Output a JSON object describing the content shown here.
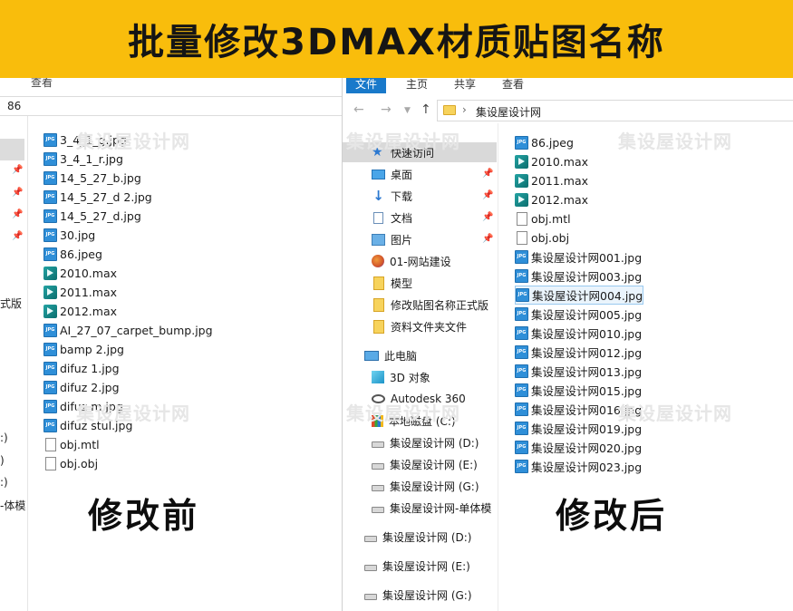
{
  "banner": {
    "title": "批量修改3DMAX材质贴图名称"
  },
  "left_window": {
    "ribbon_tab_visible": "查看",
    "address_text": "86",
    "nav_partial_labels": [
      "式版",
      ":)",
      ")",
      ":)",
      "-体模"
    ],
    "files": [
      {
        "name": "3_4_1_g.jpg",
        "type": "jpg"
      },
      {
        "name": "3_4_1_r.jpg",
        "type": "jpg"
      },
      {
        "name": "14_5_27_b.jpg",
        "type": "jpg"
      },
      {
        "name": "14_5_27_d 2.jpg",
        "type": "jpg"
      },
      {
        "name": "14_5_27_d.jpg",
        "type": "jpg"
      },
      {
        "name": "30.jpg",
        "type": "jpg"
      },
      {
        "name": "86.jpeg",
        "type": "jpg"
      },
      {
        "name": "2010.max",
        "type": "max"
      },
      {
        "name": "2011.max",
        "type": "max"
      },
      {
        "name": "2012.max",
        "type": "max"
      },
      {
        "name": "AI_27_07_carpet_bump.jpg",
        "type": "jpg"
      },
      {
        "name": "bamp 2.jpg",
        "type": "jpg"
      },
      {
        "name": "difuz 1.jpg",
        "type": "jpg"
      },
      {
        "name": "difuz 2.jpg",
        "type": "jpg"
      },
      {
        "name": "difuz m.jpg",
        "type": "jpg"
      },
      {
        "name": "difuz stul.jpg",
        "type": "jpg"
      },
      {
        "name": "obj.mtl",
        "type": "doc"
      },
      {
        "name": "obj.obj",
        "type": "doc"
      }
    ],
    "caption": "修改前"
  },
  "right_window": {
    "ribbon_tabs": [
      "文件",
      "主页",
      "共享",
      "查看"
    ],
    "active_tab": "文件",
    "address_text": "集设屋设计网",
    "nav_items": [
      {
        "label": "快速访问",
        "icon": "star-icon",
        "selected": true,
        "pinned": false
      },
      {
        "label": "桌面",
        "icon": "desktop-icon",
        "pinned": true
      },
      {
        "label": "下载",
        "icon": "download-icon",
        "pinned": true
      },
      {
        "label": "文档",
        "icon": "documents-icon",
        "pinned": true
      },
      {
        "label": "图片",
        "icon": "pictures-icon",
        "pinned": true
      },
      {
        "label": "01-网站建设",
        "icon": "web-icon",
        "pinned": false
      },
      {
        "label": "模型",
        "icon": "folder-icon",
        "pinned": false
      },
      {
        "label": "修改贴图名称正式版",
        "icon": "folder-icon",
        "pinned": false
      },
      {
        "label": "资料文件夹文件",
        "icon": "folder-icon",
        "pinned": false
      },
      {
        "label": "此电脑",
        "icon": "this-pc-icon",
        "pinned": false
      },
      {
        "label": "3D 对象",
        "icon": "3d-objects-icon",
        "pinned": false
      },
      {
        "label": "Autodesk 360",
        "icon": "autodesk-360-icon",
        "pinned": false
      },
      {
        "label": "本地磁盘 (C:)",
        "icon": "local-disk-icon",
        "pinned": false
      },
      {
        "label": "集设屋设计网 (D:)",
        "icon": "drive-icon",
        "pinned": false
      },
      {
        "label": "集设屋设计网 (E:)",
        "icon": "drive-icon",
        "pinned": false
      },
      {
        "label": "集设屋设计网 (G:)",
        "icon": "drive-icon",
        "pinned": false
      },
      {
        "label": "集设屋设计网-单体模",
        "icon": "drive-icon",
        "pinned": false
      },
      {
        "label": "集设屋设计网 (D:)",
        "icon": "drive-icon",
        "pinned": false
      },
      {
        "label": "集设屋设计网 (E:)",
        "icon": "drive-icon",
        "pinned": false
      },
      {
        "label": "集设屋设计网 (G:)",
        "icon": "drive-icon",
        "pinned": false
      }
    ],
    "files": [
      {
        "name": "86.jpeg",
        "type": "jpg"
      },
      {
        "name": "2010.max",
        "type": "max"
      },
      {
        "name": "2011.max",
        "type": "max"
      },
      {
        "name": "2012.max",
        "type": "max"
      },
      {
        "name": "obj.mtl",
        "type": "doc"
      },
      {
        "name": "obj.obj",
        "type": "doc"
      },
      {
        "name": "集设屋设计网001.jpg",
        "type": "jpg"
      },
      {
        "name": "集设屋设计网003.jpg",
        "type": "jpg"
      },
      {
        "name": "集设屋设计网004.jpg",
        "type": "jpg",
        "selected": true
      },
      {
        "name": "集设屋设计网005.jpg",
        "type": "jpg"
      },
      {
        "name": "集设屋设计网010.jpg",
        "type": "jpg"
      },
      {
        "name": "集设屋设计网012.jpg",
        "type": "jpg"
      },
      {
        "name": "集设屋设计网013.jpg",
        "type": "jpg"
      },
      {
        "name": "集设屋设计网015.jpg",
        "type": "jpg"
      },
      {
        "name": "集设屋设计网016.jpg",
        "type": "jpg"
      },
      {
        "name": "集设屋设计网019.jpg",
        "type": "jpg"
      },
      {
        "name": "集设屋设计网020.jpg",
        "type": "jpg"
      },
      {
        "name": "集设屋设计网023.jpg",
        "type": "jpg"
      }
    ],
    "caption": "修改后"
  },
  "watermark": {
    "text": "集设屋设计网"
  },
  "colors": {
    "banner": "#f9bd0c",
    "accent_tab": "#1979ca",
    "selection": "#eaf4fc"
  }
}
